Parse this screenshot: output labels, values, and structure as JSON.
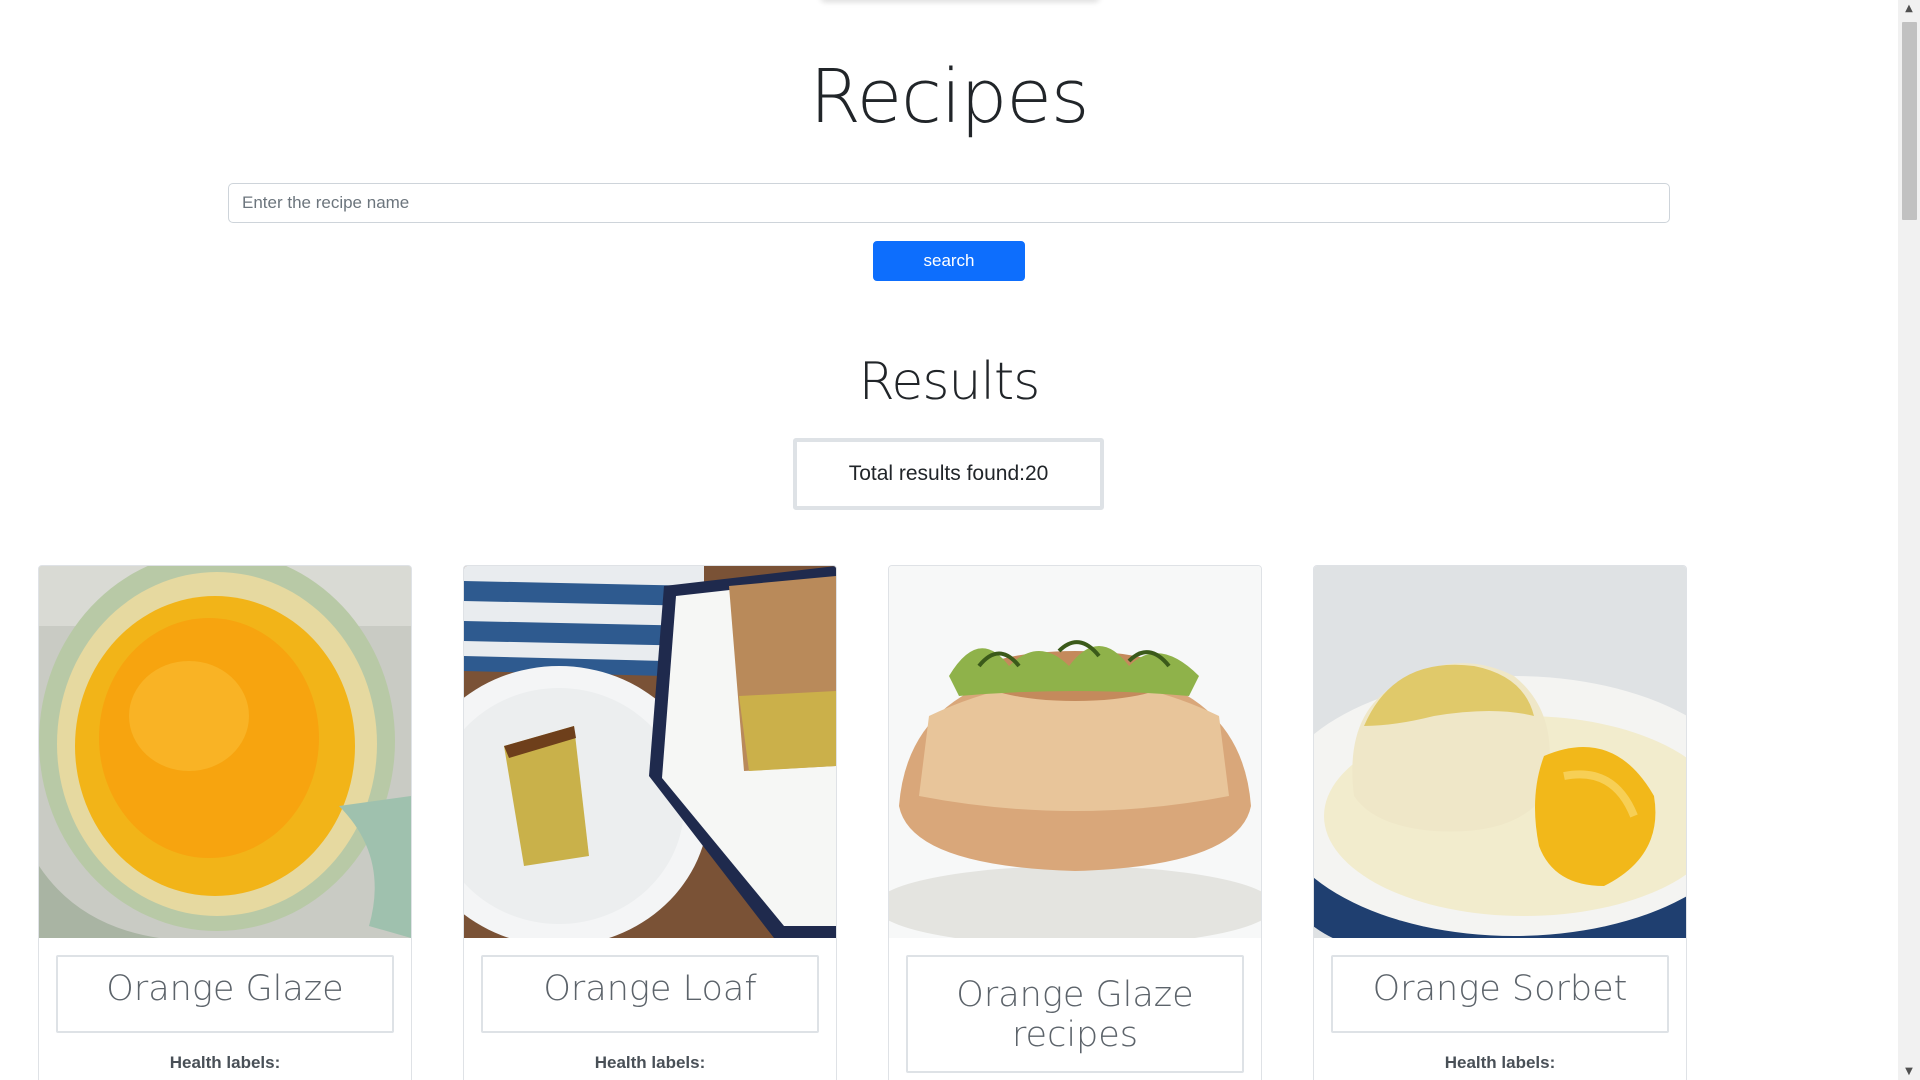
{
  "header": {
    "title": "Recipes"
  },
  "search": {
    "placeholder": "Enter the recipe name",
    "value": "",
    "button_label": "search"
  },
  "results": {
    "heading": "Results",
    "total_text": "Total results found:20"
  },
  "cards": [
    {
      "title": "Orange Glaze",
      "health_label": "Health labels:",
      "image": "orange-glaze-photo"
    },
    {
      "title": "Orange Loaf",
      "health_label": "Health labels:",
      "image": "orange-loaf-photo"
    },
    {
      "title": "Orange Glaze recipes",
      "health_label": "Health labels:",
      "image": "orange-glaze-cake-photo"
    },
    {
      "title": "Orange Sorbet",
      "health_label": "Health labels:",
      "image": "orange-sorbet-photo"
    }
  ],
  "scrollbar": {
    "up_icon": "scroll-up-arrow-icon",
    "down_icon": "scroll-down-arrow-icon"
  },
  "colors": {
    "primary_button": "#0d6efd",
    "text": "#212529",
    "muted_title": "#5c636a",
    "border": "#dee2e6"
  }
}
